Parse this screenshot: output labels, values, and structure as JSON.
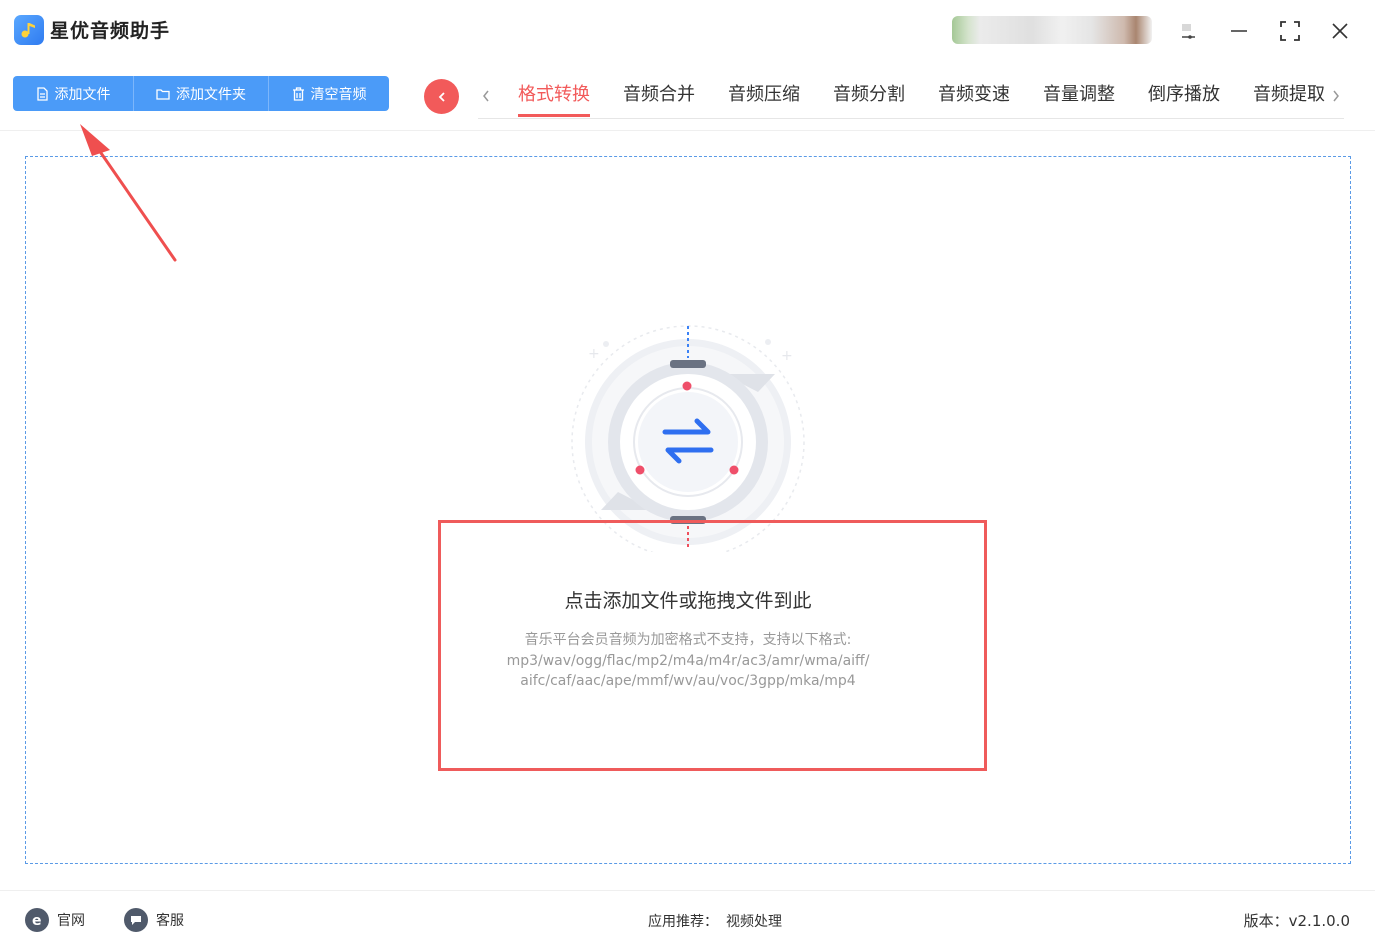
{
  "app": {
    "title": "星优音频助手"
  },
  "toolbar": {
    "add_file": "添加文件",
    "add_folder": "添加文件夹",
    "clear_audio": "清空音频"
  },
  "tabs": [
    {
      "label": "格式转换",
      "active": true
    },
    {
      "label": "音频合并",
      "active": false
    },
    {
      "label": "音频压缩",
      "active": false
    },
    {
      "label": "音频分割",
      "active": false
    },
    {
      "label": "音频变速",
      "active": false
    },
    {
      "label": "音量调整",
      "active": false
    },
    {
      "label": "倒序播放",
      "active": false
    },
    {
      "label": "音频提取",
      "active": false
    }
  ],
  "dropzone": {
    "title": "点击添加文件或拖拽文件到此",
    "line1": "音乐平台会员音频为加密格式不支持，支持以下格式:",
    "line2": "mp3/wav/ogg/flac/mp2/m4a/m4r/ac3/amr/wma/aiff/",
    "line3": "aifc/caf/aac/ape/mmf/wv/au/voc/3gpp/mka/mp4"
  },
  "footer": {
    "website": "官网",
    "support": "客服",
    "recommend_label": "应用推荐：",
    "recommend_link": "视频处理",
    "version": "版本：v2.1.0.0"
  },
  "icons": {
    "logo": "music-note-icon",
    "add_file": "file-icon",
    "add_folder": "folder-icon",
    "clear": "trash-icon",
    "back": "chevron-left-icon",
    "convert": "swap-arrows-icon",
    "website": "ie-browser-icon",
    "support": "chat-bubble-icon"
  },
  "colors": {
    "accent_blue": "#4b9bf8",
    "accent_red": "#f25a5a",
    "dropzone_border": "#5a9ae6",
    "annotation_red": "#ef5b5b"
  }
}
